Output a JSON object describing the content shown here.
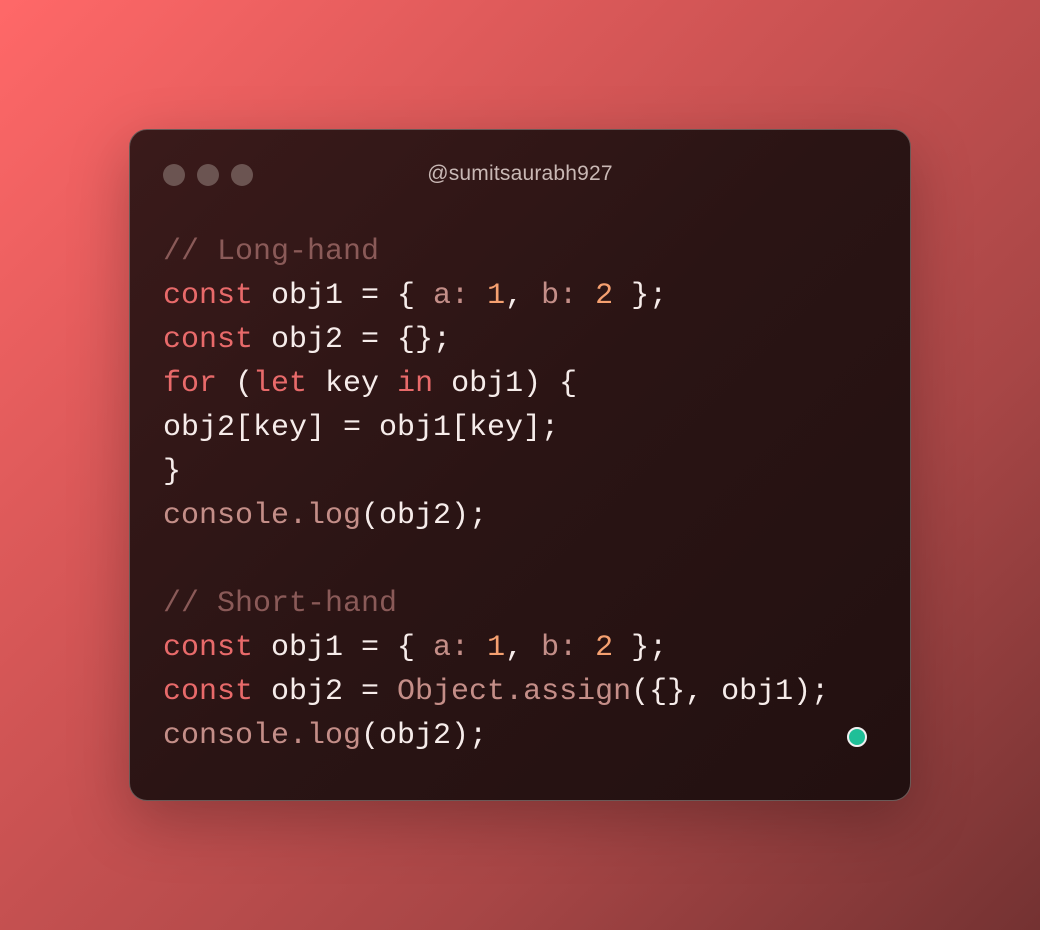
{
  "window": {
    "title": "@sumitsaurabh927"
  },
  "colors": {
    "keyword": "#e86a6a",
    "plain": "#f6ecea",
    "comment": "#8a5a58",
    "property": "#c48e88",
    "number": "#f5a070",
    "status": "#1fbf98"
  },
  "code": [
    [
      {
        "t": "// Long-hand",
        "c": "cm"
      }
    ],
    [
      {
        "t": "const",
        "c": "kw"
      },
      {
        "t": " obj1 = { ",
        "c": "pl"
      },
      {
        "t": "a:",
        "c": "pr"
      },
      {
        "t": " ",
        "c": "pl"
      },
      {
        "t": "1",
        "c": "nu"
      },
      {
        "t": ", ",
        "c": "pl"
      },
      {
        "t": "b:",
        "c": "pr"
      },
      {
        "t": " ",
        "c": "pl"
      },
      {
        "t": "2",
        "c": "nu"
      },
      {
        "t": " };",
        "c": "pl"
      }
    ],
    [
      {
        "t": "const",
        "c": "kw"
      },
      {
        "t": " obj2 = {};",
        "c": "pl"
      }
    ],
    [
      {
        "t": "for",
        "c": "kw"
      },
      {
        "t": " (",
        "c": "pl"
      },
      {
        "t": "let",
        "c": "kw"
      },
      {
        "t": " key ",
        "c": "pl"
      },
      {
        "t": "in",
        "c": "kw"
      },
      {
        "t": " obj1) {",
        "c": "pl"
      }
    ],
    [
      {
        "t": "obj2[key] = obj1[key];",
        "c": "pl"
      }
    ],
    [
      {
        "t": "}",
        "c": "pl"
      }
    ],
    [
      {
        "t": "console.log",
        "c": "pr"
      },
      {
        "t": "(obj2);",
        "c": "pl"
      }
    ],
    [],
    [
      {
        "t": "// Short-hand",
        "c": "cm"
      }
    ],
    [
      {
        "t": "const",
        "c": "kw"
      },
      {
        "t": " obj1 = { ",
        "c": "pl"
      },
      {
        "t": "a:",
        "c": "pr"
      },
      {
        "t": " ",
        "c": "pl"
      },
      {
        "t": "1",
        "c": "nu"
      },
      {
        "t": ", ",
        "c": "pl"
      },
      {
        "t": "b:",
        "c": "pr"
      },
      {
        "t": " ",
        "c": "pl"
      },
      {
        "t": "2",
        "c": "nu"
      },
      {
        "t": " };",
        "c": "pl"
      }
    ],
    [
      {
        "t": "const",
        "c": "kw"
      },
      {
        "t": " obj2 = ",
        "c": "pl"
      },
      {
        "t": "Object.assign",
        "c": "pr"
      },
      {
        "t": "({}, obj1);",
        "c": "pl"
      }
    ],
    [
      {
        "t": "console.log",
        "c": "pr"
      },
      {
        "t": "(obj2);",
        "c": "pl"
      }
    ]
  ]
}
